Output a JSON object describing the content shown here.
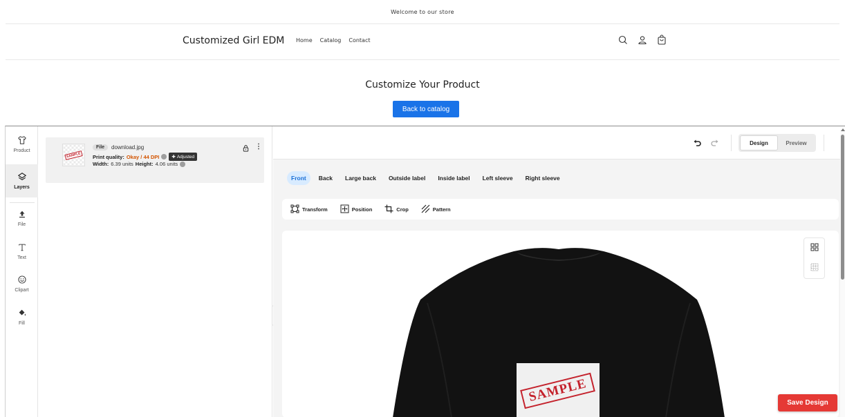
{
  "announcement": "Welcome to our store",
  "header": {
    "brand": "Customized Girl EDM",
    "nav": [
      {
        "label": "Home"
      },
      {
        "label": "Catalog"
      },
      {
        "label": "Contact"
      }
    ],
    "icons": [
      "search-icon",
      "account-icon",
      "cart-icon"
    ]
  },
  "page": {
    "title": "Customize Your Product",
    "back_button": "Back to catalog"
  },
  "tool_rail": [
    {
      "label": "Product",
      "icon": "shirt-icon"
    },
    {
      "label": "Layers",
      "icon": "layers-icon",
      "active": true
    },
    {
      "label": "File",
      "icon": "upload-icon"
    },
    {
      "label": "Text",
      "icon": "text-icon"
    },
    {
      "label": "Clipart",
      "icon": "smiley-icon"
    },
    {
      "label": "Fill",
      "icon": "paint-bucket-icon"
    }
  ],
  "layer": {
    "type_badge": "File",
    "filename": "download.jpg",
    "print_quality_label": "Print quality:",
    "print_quality_value": "Okay / 44 DPI",
    "adjusted_label": "Adjusted",
    "width_label": "Width:",
    "width_value": "6.39 units",
    "height_label": "Height:",
    "height_value": "4.06 units",
    "thumb_text": "SAMPLE"
  },
  "editor": {
    "mode_tabs": [
      {
        "label": "Design",
        "active": true
      },
      {
        "label": "Preview",
        "active": false
      }
    ],
    "sides": [
      {
        "label": "Front",
        "active": true
      },
      {
        "label": "Back"
      },
      {
        "label": "Large back"
      },
      {
        "label": "Outside label"
      },
      {
        "label": "Inside label"
      },
      {
        "label": "Left sleeve"
      },
      {
        "label": "Right sleeve"
      }
    ],
    "options": [
      {
        "label": "Transform",
        "icon": "transform-icon"
      },
      {
        "label": "Position",
        "icon": "position-icon"
      },
      {
        "label": "Crop",
        "icon": "crop-icon"
      },
      {
        "label": "Pattern",
        "icon": "pattern-icon"
      }
    ],
    "print_text": "SAMPLE"
  },
  "save_button": "Save Design",
  "colors": {
    "primary_blue": "#1a73e8",
    "save_red": "#e53935",
    "warning_orange": "#d35400",
    "shirt": "#121212"
  }
}
